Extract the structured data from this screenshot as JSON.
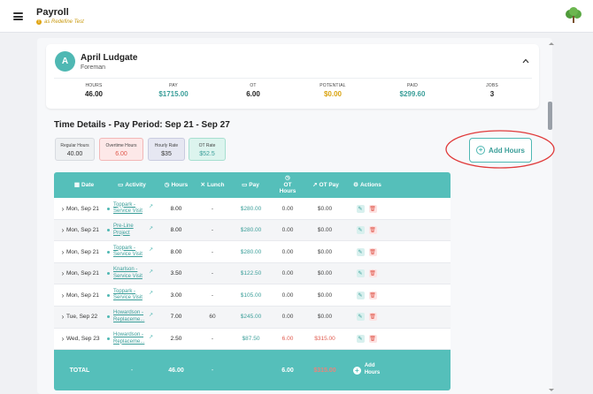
{
  "header": {
    "title": "Payroll",
    "subtitle": "as Redefine Test"
  },
  "worker": {
    "initial": "A",
    "name": "April Ludgate",
    "role": "Foreman",
    "stats": [
      {
        "label": "HOURS",
        "value": "46.00",
        "color": "#222222"
      },
      {
        "label": "PAY",
        "value": "$1715.00",
        "color": "#3a9e99"
      },
      {
        "label": "OT",
        "value": "6.00",
        "color": "#222222"
      },
      {
        "label": "POTENTIAL",
        "value": "$0.00",
        "color": "#d9a310"
      },
      {
        "label": "PAID",
        "value": "$299.60",
        "color": "#3a9e99"
      },
      {
        "label": "JOBS",
        "value": "3",
        "color": "#222222"
      }
    ]
  },
  "time_details": {
    "title": "Time Details - Pay Period: Sep 21 - Sep 27",
    "chips": {
      "regular": {
        "label": "Regular Hours",
        "value": "40.00"
      },
      "overtime": {
        "label": "Overtime Hours",
        "value": "6.00"
      },
      "hourly": {
        "label": "Hourly Rate",
        "value": "$35"
      },
      "ot": {
        "label": "OT Rate",
        "value": "$52.5"
      }
    },
    "add_hours_label": "Add Hours"
  },
  "table": {
    "headers": {
      "date": "Date",
      "activity": "Activity",
      "hours": "Hours",
      "lunch": "Lunch",
      "pay": "Pay",
      "ot_hours": "OT Hours",
      "ot_pay": "OT Pay",
      "actions": "Actions"
    },
    "rows": [
      {
        "date": "Mon, Sep 21",
        "activity": "Toppark - Service Visit",
        "hours": "8.00",
        "lunch": "-",
        "pay": "$280.00",
        "ot_hours": "0.00",
        "ot_pay": "$0.00"
      },
      {
        "date": "Mon, Sep 21",
        "activity": "Pre-Line Project",
        "hours": "8.00",
        "lunch": "-",
        "pay": "$280.00",
        "ot_hours": "0.00",
        "ot_pay": "$0.00"
      },
      {
        "date": "Mon, Sep 21",
        "activity": "Toppark - Service Visit",
        "hours": "8.00",
        "lunch": "-",
        "pay": "$280.00",
        "ot_hours": "0.00",
        "ot_pay": "$0.00"
      },
      {
        "date": "Mon, Sep 21",
        "activity": "Knarlson - Service Visit",
        "hours": "3.50",
        "lunch": "-",
        "pay": "$122.50",
        "ot_hours": "0.00",
        "ot_pay": "$0.00"
      },
      {
        "date": "Mon, Sep 21",
        "activity": "Toppark - Service Visit",
        "hours": "3.00",
        "lunch": "-",
        "pay": "$105.00",
        "ot_hours": "0.00",
        "ot_pay": "$0.00"
      },
      {
        "date": "Tue, Sep 22",
        "activity": "Howardson - Replaceme...",
        "hours": "7.00",
        "lunch": "60",
        "pay": "$245.00",
        "ot_hours": "0.00",
        "ot_pay": "$0.00"
      },
      {
        "date": "Wed, Sep 23",
        "activity": "Howardson - Replaceme...",
        "hours": "2.50",
        "lunch": "-",
        "pay": "$87.50",
        "ot_hours": "6.00",
        "ot_pay": "$315.00"
      }
    ],
    "footer": {
      "label": "TOTAL",
      "activity": "-",
      "hours": "46.00",
      "lunch": "-",
      "ot_hours": "6.00",
      "ot_pay": "$315.00",
      "add_label": "Add Hours"
    }
  },
  "colors": {
    "accent": "#55bfba",
    "annotation": "#e03a3a"
  }
}
